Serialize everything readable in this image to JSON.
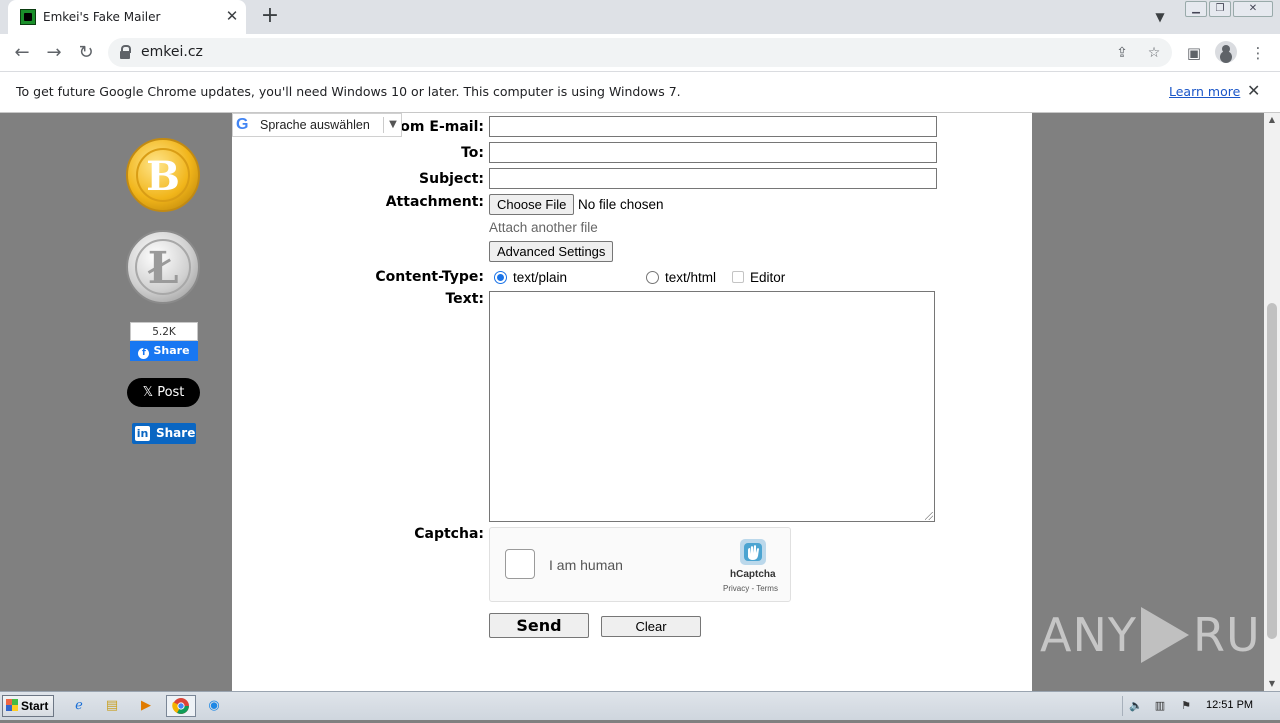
{
  "browser": {
    "tab_title": "Emkei's Fake Mailer",
    "tab_close_glyph": "✕",
    "new_tab_glyph": "+",
    "url": "emkei.cz",
    "infobar_message": "To get future Google Chrome updates, you'll need Windows 10 or later. This computer is using Windows 7.",
    "infobar_link": "Learn more",
    "infobar_close_glyph": "✕"
  },
  "sidebar": {
    "bitcoin_symbol": "B",
    "litecoin_symbol": "Ł",
    "fb_count": "5.2K",
    "fb_share": "Share",
    "x_post": "Post",
    "linkedin_share": "Share"
  },
  "translate": {
    "label": "Sprache auswählen",
    "arrow": "▼"
  },
  "form": {
    "from_email_label": "From E-mail:",
    "to_label": "To:",
    "subject_label": "Subject:",
    "attachment_label": "Attachment:",
    "choose_file": "Choose File",
    "no_file": "No file chosen",
    "attach_another": "Attach another file",
    "advanced_settings": "Advanced Settings",
    "content_type_label": "Content-Type:",
    "content_type_options": [
      "text/plain",
      "text/html",
      "Editor"
    ],
    "content_type_selected": "text/plain",
    "text_label": "Text:",
    "captcha_label": "Captcha:",
    "captcha_checkbox_text": "I am human",
    "captcha_brand": "hCaptcha",
    "captcha_terms": "Privacy - Terms",
    "send": "Send",
    "clear": "Clear"
  },
  "watermark": {
    "left": "ANY",
    "right": "RUN"
  },
  "taskbar": {
    "start": "Start",
    "clock": "12:51 PM"
  },
  "icons": [
    "lock-icon",
    "back-icon",
    "forward-icon",
    "reload-icon",
    "share-icon",
    "star-icon",
    "sidepanel-icon",
    "profile-icon",
    "menu-icon",
    "google-g-icon",
    "hcaptcha-logo-icon"
  ]
}
